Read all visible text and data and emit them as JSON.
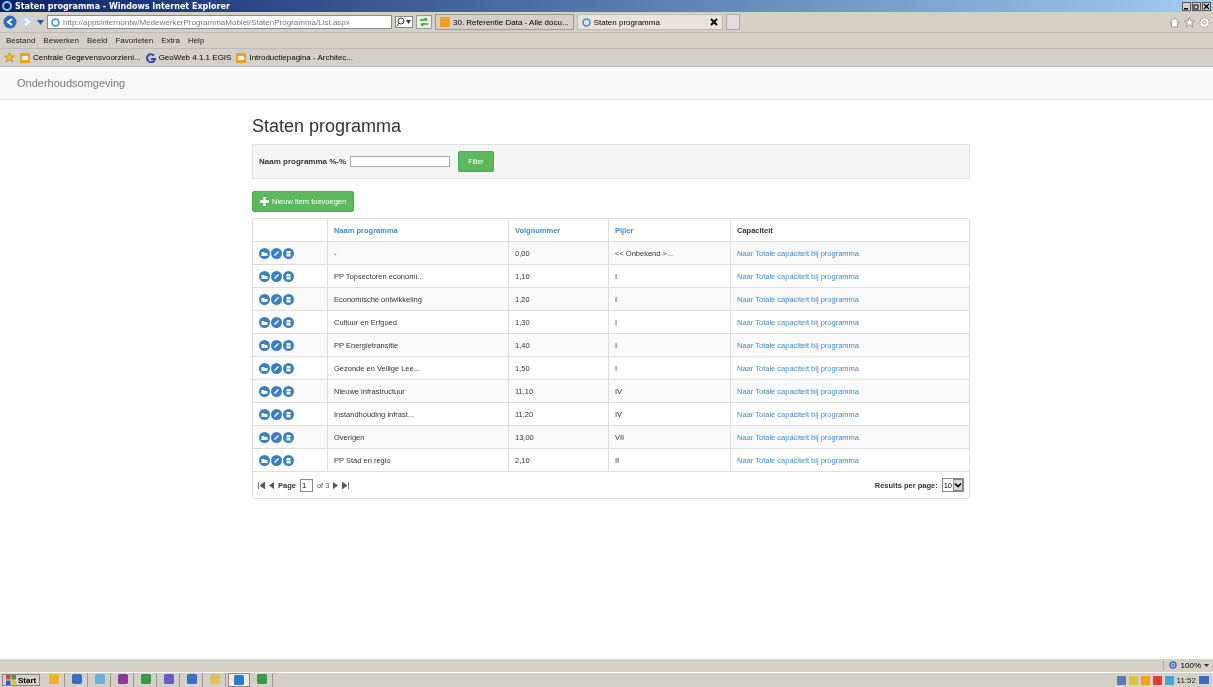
{
  "window": {
    "title": "Staten programma - Windows Internet Explorer"
  },
  "address_bar": {
    "url": "http://appsinternontw/MedewerkerProgrammaMobiel/StatenProgramma/List.aspx"
  },
  "tabs": [
    {
      "label": "30. Referentie Data - Alle docu...",
      "selected": false
    },
    {
      "label": "Staten programma",
      "selected": true
    }
  ],
  "menu": [
    "Bestand",
    "Bewerken",
    "Beeld",
    "Favorieten",
    "Extra",
    "Help"
  ],
  "favorites": [
    {
      "label": "Centrale Gegevensvoorzieni...",
      "kind": "orange"
    },
    {
      "label": "GeoWeb 4.1.1 EGIS",
      "kind": "g"
    },
    {
      "label": "Introductiepagina - Architec...",
      "kind": "orange"
    }
  ],
  "navbar": {
    "brand": "Onderhoudsomgeving"
  },
  "page": {
    "title": "Staten programma",
    "filter": {
      "label": "Naam programma %-%",
      "button": "Filter"
    },
    "add_button": "Nieuw item toevoegen",
    "table": {
      "columns": [
        {
          "label": "Naam programma",
          "sortable": true
        },
        {
          "label": "Volgnummer",
          "sortable": true
        },
        {
          "label": "Pijler",
          "sortable": true
        },
        {
          "label": "Capaciteit",
          "sortable": false
        }
      ],
      "rows": [
        {
          "name": "-",
          "volgnummer": "0,00",
          "pijler": "<< Onbekend >...",
          "capaciteit": "Naar Totale capaciteit bij programma"
        },
        {
          "name": "PP Topsectoren economi...",
          "volgnummer": "1,10",
          "pijler": "I",
          "capaciteit": "Naar Totale capaciteit bij programma"
        },
        {
          "name": "Economische ontwikkeling",
          "volgnummer": "1,20",
          "pijler": "I",
          "capaciteit": "Naar Totale capaciteit bij programma"
        },
        {
          "name": "Cultuur en Erfgoed",
          "volgnummer": "1,30",
          "pijler": "I",
          "capaciteit": "Naar Totale capaciteit bij programma"
        },
        {
          "name": "PP Energietransitie",
          "volgnummer": "1,40",
          "pijler": "I",
          "capaciteit": "Naar Totale capaciteit bij programma"
        },
        {
          "name": "Gezonde en Veilige Lee...",
          "volgnummer": "1,50",
          "pijler": "I",
          "capaciteit": "Naar Totale capaciteit bij programma"
        },
        {
          "name": "Nieuwe infrastructuur",
          "volgnummer": "11,10",
          "pijler": "IV",
          "capaciteit": "Naar Totale capaciteit bij programma"
        },
        {
          "name": "Instandhouding infrast...",
          "volgnummer": "11,20",
          "pijler": "IV",
          "capaciteit": "Naar Totale capaciteit bij programma"
        },
        {
          "name": "Overigen",
          "volgnummer": "13,00",
          "pijler": "VII",
          "capaciteit": "Naar Totale capaciteit bij programma"
        },
        {
          "name": "PP Stad en regio",
          "volgnummer": "2,10",
          "pijler": "II",
          "capaciteit": "Naar Totale capaciteit bij programma"
        }
      ]
    },
    "pager": {
      "page_label": "Page",
      "page": "1",
      "of": "of 3",
      "per_page_label": "Results per page:",
      "per_page": "10"
    }
  },
  "status_bar": {
    "zoom": "100%"
  },
  "taskbar": {
    "start": "Start",
    "apps": [
      {
        "color": "#f0b030",
        "selected": false
      },
      {
        "color": "#3a6fc4",
        "selected": false
      },
      {
        "color": "#6aaee0",
        "selected": false
      },
      {
        "color": "#8a3a9a",
        "selected": false
      },
      {
        "color": "#3a9a4a",
        "selected": false
      },
      {
        "color": "#6a5ac8",
        "selected": false
      },
      {
        "color": "#3a6fc4",
        "selected": false
      },
      {
        "color": "#e0c060",
        "selected": false
      },
      {
        "color": "#2a7ad0",
        "selected": true
      },
      {
        "color": "#3a9a4a",
        "selected": false
      }
    ],
    "clock": "11:52"
  }
}
